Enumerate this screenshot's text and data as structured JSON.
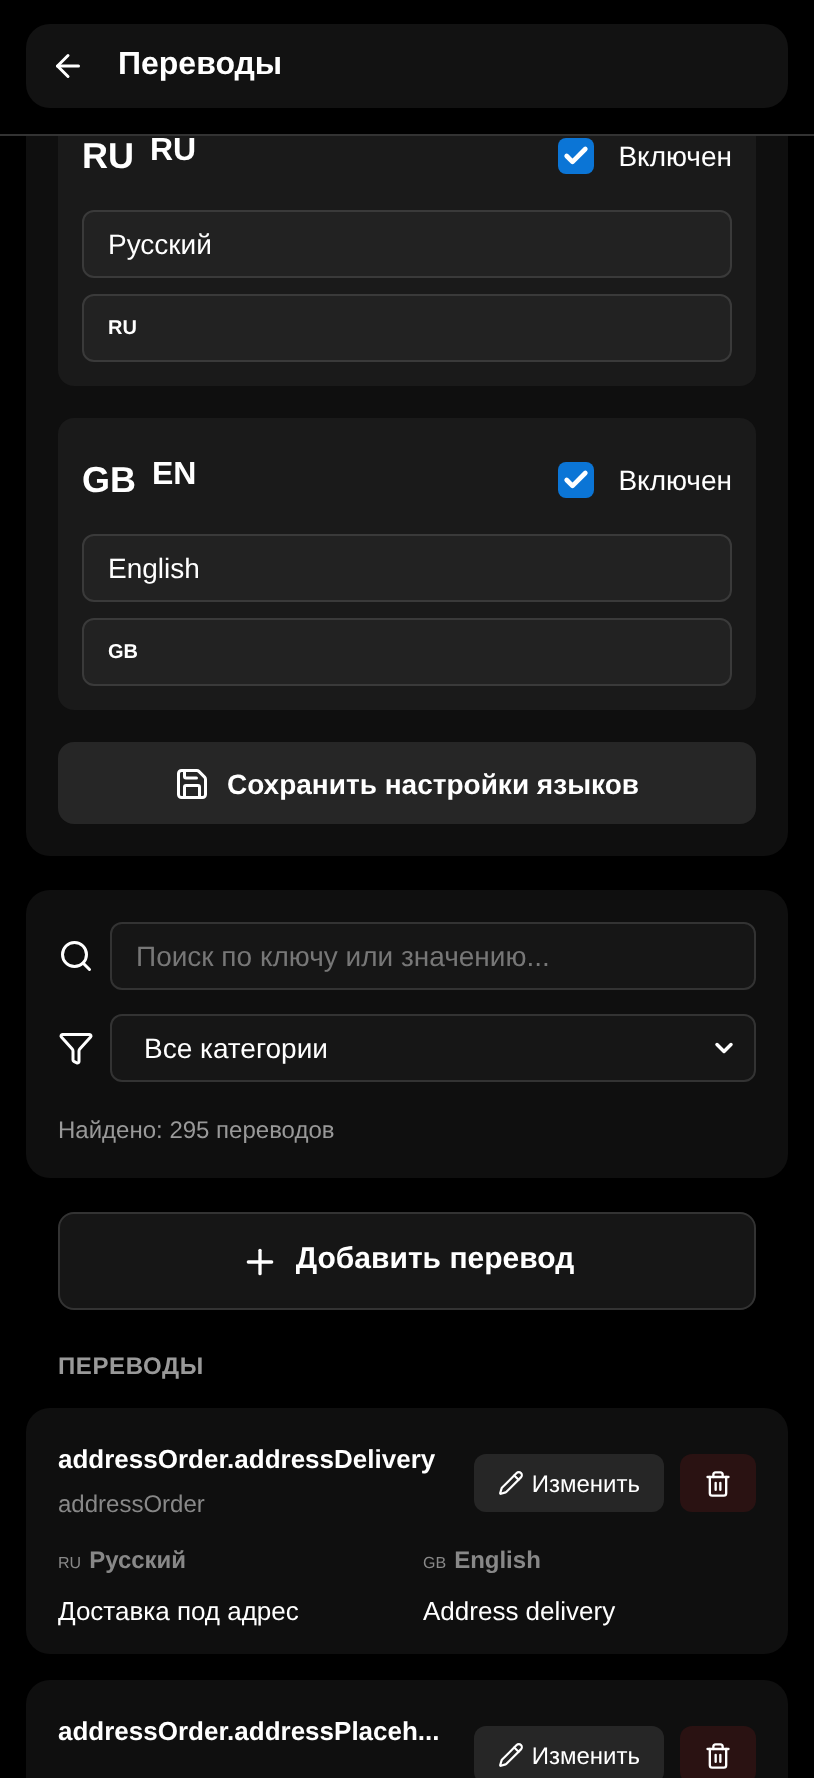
{
  "header": {
    "title": "Переводы"
  },
  "languages": [
    {
      "flag": "RU",
      "code": "RU",
      "enabled": true,
      "enabled_label": "Включен",
      "name": "Русский",
      "flag_value": "RU"
    },
    {
      "flag": "GB",
      "code": "EN",
      "enabled": true,
      "enabled_label": "Включен",
      "name": "English",
      "flag_value": "GB"
    }
  ],
  "save_button": "Сохранить настройки языков",
  "filters": {
    "search_placeholder": "Поиск по ключу или значению...",
    "category": "Все категории",
    "found": "Найдено: 295 переводов"
  },
  "add_button": "Добавить перевод",
  "section_label": "ПЕРЕВОДЫ",
  "translations": [
    {
      "key": "addressOrder.addressDelivery",
      "category": "addressOrder",
      "edit": "Изменить",
      "values": [
        {
          "flag": "RU",
          "language": "Русский",
          "text": "Доставка под адрес"
        },
        {
          "flag": "GB",
          "language": "English",
          "text": "Address delivery"
        }
      ]
    },
    {
      "key": "addressOrder.addressPlaceh...",
      "edit": "Изменить"
    }
  ]
}
